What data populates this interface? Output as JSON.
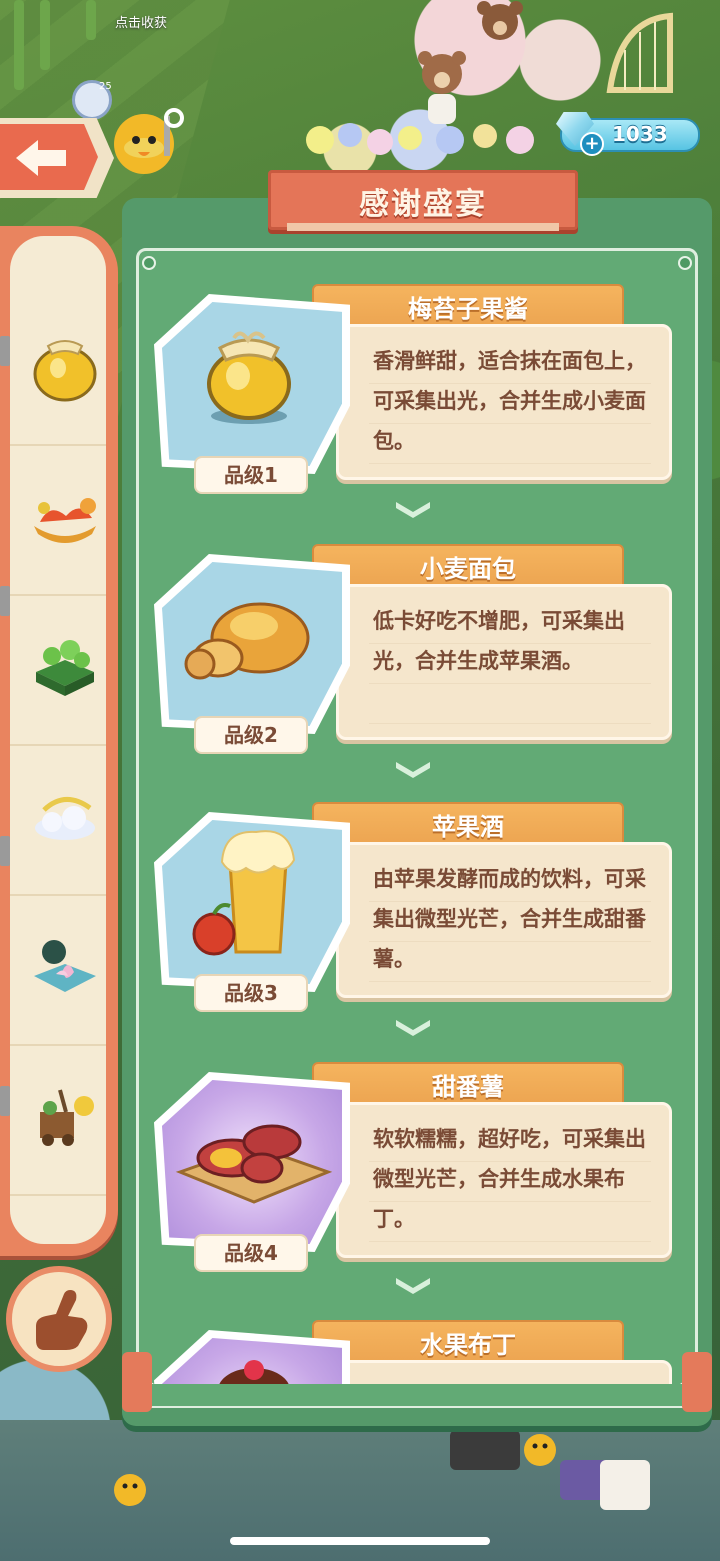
{
  "world": {
    "harvest_hint": "点击收获",
    "timer_badge": "25"
  },
  "currency": {
    "diamonds": "1033",
    "add_symbol": "+"
  },
  "panel": {
    "title": "感谢盛宴"
  },
  "recipes": [
    {
      "name": "梅苔子果酱",
      "description": "香滑鲜甜，适合抹在面包上，可采集出光，合并生成小麦面包。",
      "grade": "品级1",
      "icon": "honey-jar-icon"
    },
    {
      "name": "小麦面包",
      "description": "低卡好吃不增肥，可采集出光，合并生成苹果酒。",
      "grade": "品级2",
      "icon": "bread-icon"
    },
    {
      "name": "苹果酒",
      "description": "由苹果发酵而成的饮料，可采集出微型光芒，合并生成甜番薯。",
      "grade": "品级3",
      "icon": "cider-icon"
    },
    {
      "name": "甜番薯",
      "description": "软软糯糯，超好吃，可采集出微型光芒，合并生成水果布丁。",
      "grade": "品级4",
      "icon": "sweet-potato-icon"
    },
    {
      "name": "水果布丁",
      "description": "",
      "grade": "",
      "icon": "pudding-icon"
    }
  ],
  "sidebar": {
    "items": [
      {
        "icon": "honey-jar-icon"
      },
      {
        "icon": "dragon-boat-icon"
      },
      {
        "icon": "clover-garden-icon"
      },
      {
        "icon": "cloud-island-icon"
      },
      {
        "icon": "lotus-pond-icon"
      },
      {
        "icon": "treasure-cart-icon"
      }
    ]
  },
  "colors": {
    "panel_green": "#559a6a",
    "ribbon_red": "#e47558",
    "tab_orange": "#f5b45e",
    "text_brown": "#7a4b36"
  }
}
